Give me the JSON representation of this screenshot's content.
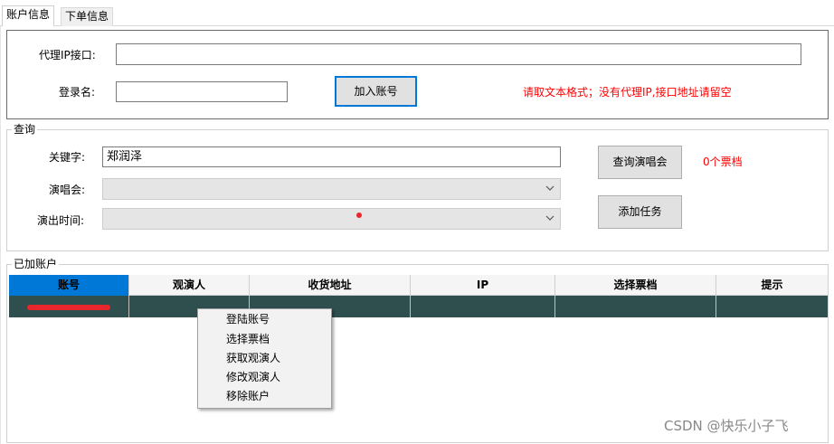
{
  "tabs": [
    {
      "label": "账户信息",
      "active": true
    },
    {
      "label": "下单信息",
      "active": false
    }
  ],
  "account_panel": {
    "proxy_label": "代理IP接口:",
    "proxy_value": "",
    "login_label": "登录名:",
    "login_value": "",
    "add_button": "加入账号",
    "hint": "请取文本格式；没有代理IP,接口地址请留空"
  },
  "query": {
    "title": "查询",
    "keyword_label": "关键字:",
    "keyword_value": "郑润泽",
    "concert_label": "演唱会:",
    "concert_value": "",
    "time_label": "演出时间:",
    "time_value": "",
    "query_button": "查询演唱会",
    "add_task_button": "添加任务",
    "ticket_count": "0个票档"
  },
  "accounts": {
    "title": "已加账户",
    "columns": [
      "账号",
      "观演人",
      "收货地址",
      "IP",
      "选择票档",
      "提示"
    ],
    "rows": [
      {
        "account": "",
        "viewer": "",
        "address": "",
        "ip": "",
        "ticket": "",
        "tip": ""
      }
    ]
  },
  "context_menu": {
    "items": [
      "登陆账号",
      "选择票档",
      "获取观演人",
      "修改观演人",
      "移除账户"
    ]
  },
  "watermark": "CSDN @快乐小子飞",
  "colors": {
    "accent": "#0078d7",
    "row_selected": "#2f4f4f",
    "hint_red": "#ff0000"
  },
  "icons": [
    "chevron-down-icon"
  ]
}
